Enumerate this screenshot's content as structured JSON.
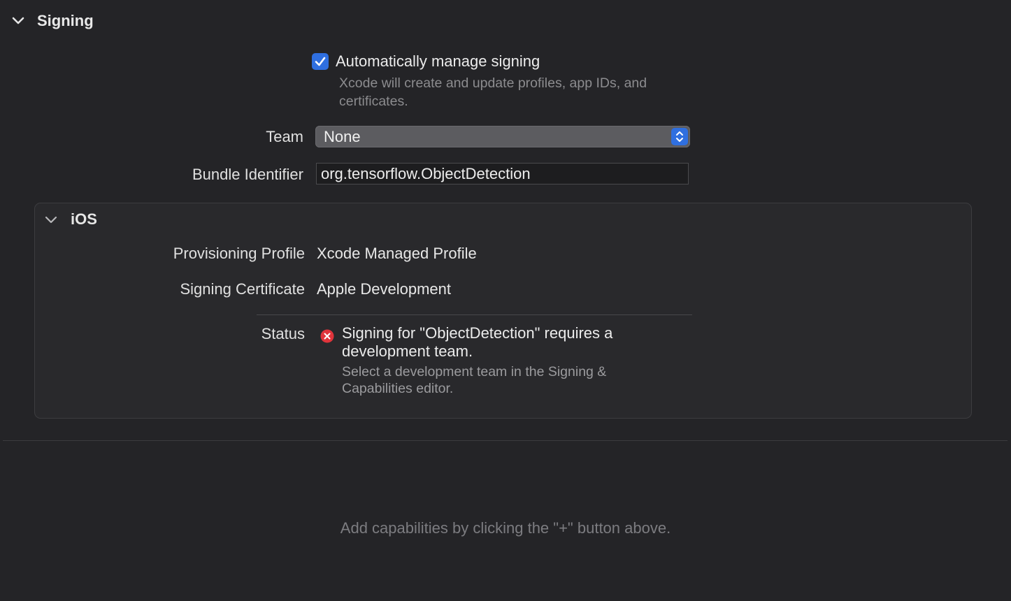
{
  "signing": {
    "title": "Signing",
    "auto_manage": {
      "checked": true,
      "label": "Automatically manage signing",
      "help_line1": "Xcode will create and update profiles, app IDs, and",
      "help_line2": "certificates."
    },
    "team": {
      "label": "Team",
      "value": "None"
    },
    "bundle_identifier": {
      "label": "Bundle Identifier",
      "value": "org.tensorflow.ObjectDetection"
    }
  },
  "ios": {
    "title": "iOS",
    "provisioning_profile": {
      "label": "Provisioning Profile",
      "value": "Xcode Managed Profile"
    },
    "signing_certificate": {
      "label": "Signing Certificate",
      "value": "Apple Development"
    },
    "status": {
      "label": "Status",
      "icon": "error-icon",
      "message_line1": "Signing for \"ObjectDetection\" requires a",
      "message_line2": "development team.",
      "detail_line1": "Select a development team in the Signing &",
      "detail_line2": "Capabilities editor."
    }
  },
  "capabilities_hint": "Add capabilities by clicking the \"+\" button above.",
  "colors": {
    "background": "#242427",
    "accent": "#2f6fe0",
    "error": "#e0343b"
  }
}
